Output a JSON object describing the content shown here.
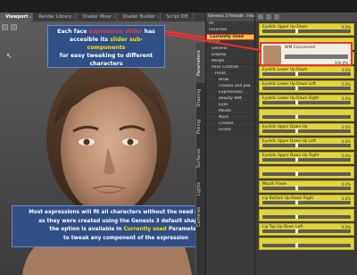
{
  "tabs": [
    {
      "label": "Viewport"
    },
    {
      "label": "Render Library"
    },
    {
      "label": "Shader Mixer"
    },
    {
      "label": "Shader Builder"
    },
    {
      "label": "Script IDE"
    }
  ],
  "callout_top": {
    "line1_a": "Each face ",
    "line1_b": "expression slider",
    "line1_c": " has",
    "line2_a": "accesible its ",
    "line2_b": "slider sub-components",
    "line3": "for easy tweaking to different",
    "line4": "characters"
  },
  "callout_bottom": {
    "line1": "Most expressions will fit all characters without the need of editing",
    "line2": "as they were created using the Genesis 3 default shape but",
    "line3_a": "the option is available in ",
    "line3_b": "Currently used",
    "line3_c": " Parameters",
    "line4": "to tweak any component of the expression"
  },
  "side_tabs": [
    "Parameters",
    "Shaping",
    "Posing",
    "Surfaces",
    "Lights",
    "Cameras"
  ],
  "scene": {
    "header": "Genesis 3 Female : Head",
    "items": [
      {
        "label": "All",
        "level": 0
      },
      {
        "label": "Favorites",
        "level": 0
      },
      {
        "label": "Currently Used",
        "level": 0,
        "selected": true
      },
      {
        "label": "Head",
        "level": 0
      },
      {
        "label": "General",
        "level": 1
      },
      {
        "label": "Display",
        "level": 1
      },
      {
        "label": "Morph",
        "level": 1
      },
      {
        "label": "Pose Controls",
        "level": 1
      },
      {
        "label": "Head",
        "level": 2
      },
      {
        "label": "Brow",
        "level": 3
      },
      {
        "label": "Cheeks and Jaw",
        "level": 3
      },
      {
        "label": "Expressions",
        "level": 3
      },
      {
        "label": "Beauty WM",
        "level": 3
      },
      {
        "label": "Eyes",
        "level": 3
      },
      {
        "label": "Mouth",
        "level": 3
      },
      {
        "label": "Nose",
        "level": 3
      },
      {
        "label": "Cheeks",
        "level": 3
      },
      {
        "label": "Grime",
        "level": 3
      }
    ]
  },
  "morph_card": {
    "name": "WM Concerned",
    "value": "100.0%"
  },
  "params": [
    {
      "label": "Eyelids Upper Up-Down",
      "value": "0.0%"
    },
    {
      "label": "",
      "value": ""
    },
    {
      "label": "",
      "value": ""
    },
    {
      "label": "Eyelids Lower Up-Down",
      "value": "0.0%"
    },
    {
      "label": "Eyelids Lower Up-Down Left",
      "value": "0.0%"
    },
    {
      "label": "Eyelids Lower Up-Down Right",
      "value": "0.0%"
    },
    {
      "label": "",
      "value": ""
    },
    {
      "label": "Eyelids Upper Down-Up",
      "value": "0.0%"
    },
    {
      "label": "Eyelids Upper Down-Up Left",
      "value": "0.0%"
    },
    {
      "label": "Eyelids Upper Down-Up Right",
      "value": "0.0%"
    },
    {
      "label": "",
      "value": ""
    },
    {
      "label": "Mouth Frown",
      "value": "0.0%"
    },
    {
      "label": "Lip Bottom Up-Down Right",
      "value": "0.0%"
    },
    {
      "label": "",
      "value": ""
    },
    {
      "label": "Lip Top Up-Down Left",
      "value": "0.0%"
    },
    {
      "label": "",
      "value": ""
    }
  ],
  "colors": {
    "accent_yellow": "#e2d43a",
    "callout_blue": "#2f4f86",
    "highlight_red": "#ff3a2e"
  }
}
